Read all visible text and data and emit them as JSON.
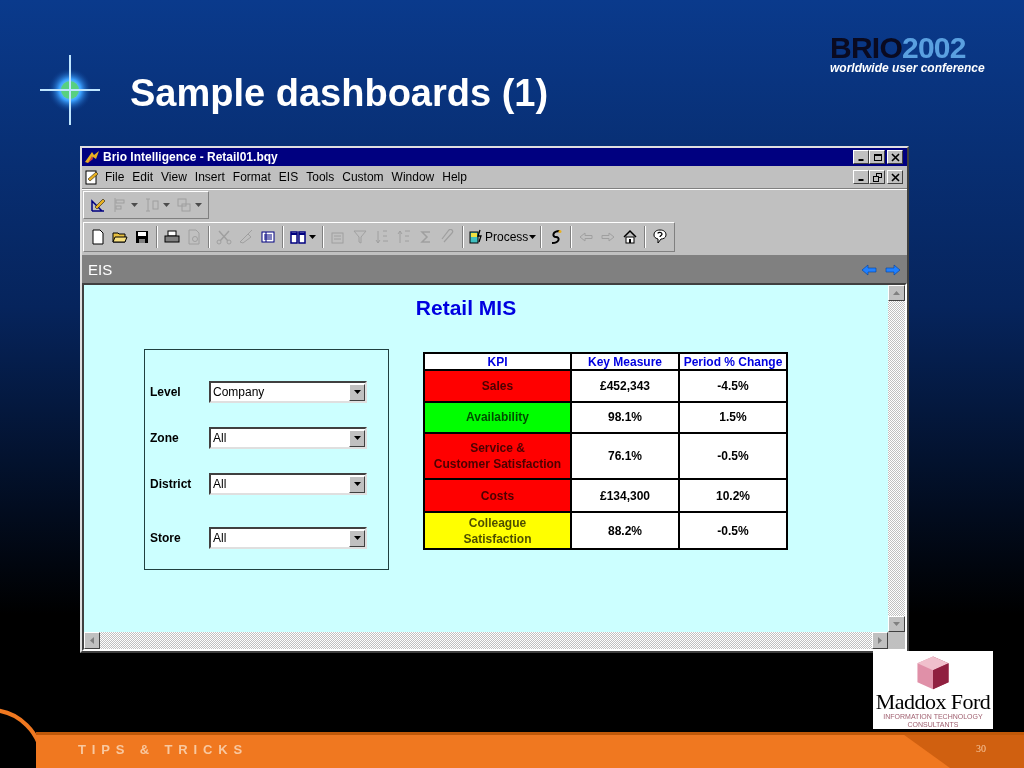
{
  "slide": {
    "title": "Sample dashboards (1)",
    "page": "30",
    "footer": "TIPS & TRICKS"
  },
  "brio_logo": {
    "wordmark": "BRIO",
    "year": "2002",
    "tagline": "worldwide user conference"
  },
  "partner_logo": {
    "name": "Maddox Ford",
    "tagline": "INFORMATION TECHNOLOGY CONSULTANTS"
  },
  "window": {
    "title": "Brio Intelligence - Retail01.bqy"
  },
  "menu": [
    "File",
    "Edit",
    "View",
    "Insert",
    "Format",
    "EIS",
    "Tools",
    "Custom",
    "Window",
    "Help"
  ],
  "toolbar_1": [
    [
      {
        "kind": "icon",
        "disabled": false,
        "dropdown": false
      },
      {
        "kind": "icon",
        "disabled": true,
        "dropdown": true
      },
      {
        "kind": "icon",
        "disabled": true,
        "dropdown": true
      },
      {
        "kind": "icon",
        "disabled": true,
        "dropdown": true
      }
    ]
  ],
  "toolbar_2": [
    [
      {
        "kind": "icon",
        "disabled": false,
        "dropdown": false
      },
      {
        "kind": "icon",
        "disabled": false,
        "dropdown": false
      },
      {
        "kind": "icon",
        "disabled": false,
        "dropdown": false
      }
    ],
    [
      {
        "kind": "icon",
        "disabled": false,
        "dropdown": false
      },
      {
        "kind": "icon",
        "disabled": true,
        "dropdown": false
      }
    ],
    [
      {
        "kind": "icon",
        "disabled": true,
        "dropdown": false
      },
      {
        "kind": "icon",
        "disabled": true,
        "dropdown": false
      },
      {
        "kind": "icon",
        "disabled": false,
        "dropdown": false
      }
    ],
    [
      {
        "kind": "icon",
        "disabled": false,
        "dropdown": true
      }
    ],
    [
      {
        "kind": "icon",
        "disabled": true,
        "dropdown": false
      },
      {
        "kind": "icon",
        "disabled": true,
        "dropdown": false
      },
      {
        "kind": "icon",
        "disabled": true,
        "dropdown": false
      },
      {
        "kind": "icon",
        "disabled": true,
        "dropdown": false
      },
      {
        "kind": "icon",
        "disabled": true,
        "dropdown": false
      },
      {
        "kind": "icon",
        "disabled": true,
        "dropdown": false
      }
    ],
    [
      {
        "kind": "text",
        "label": "Process",
        "disabled": false,
        "dropdown": true
      }
    ],
    [
      {
        "kind": "icon",
        "disabled": false,
        "dropdown": false
      }
    ],
    [
      {
        "kind": "icon",
        "disabled": true,
        "dropdown": false
      },
      {
        "kind": "icon",
        "disabled": true,
        "dropdown": false
      },
      {
        "kind": "icon",
        "disabled": false,
        "dropdown": false
      }
    ],
    [
      {
        "kind": "icon",
        "disabled": false,
        "dropdown": false
      }
    ]
  ],
  "section": {
    "title": "EIS"
  },
  "dashboard": {
    "title": "Retail MIS",
    "filters": [
      {
        "label": "Level",
        "value": "Company"
      },
      {
        "label": "Zone",
        "value": "All"
      },
      {
        "label": "District",
        "value": "All"
      },
      {
        "label": "Store",
        "value": "All"
      }
    ],
    "table": {
      "columns": [
        "KPI",
        "Key Measure",
        "Period % Change"
      ],
      "rows": [
        {
          "kpi": "Sales",
          "color": "#ff0000",
          "measure": "£452,343",
          "change": "-4.5%"
        },
        {
          "kpi": "Availability",
          "color": "#00ff00",
          "measure": "98.1%",
          "change": "1.5%"
        },
        {
          "kpi": "Service &\nCustomer Satisfaction",
          "color": "#ff0000",
          "measure": "76.1%",
          "change": "-0.5%"
        },
        {
          "kpi": "Costs",
          "color": "#ff0000",
          "measure": "£134,300",
          "change": "10.2%"
        },
        {
          "kpi": "Colleague\nSatisfaction",
          "color": "#ffff00",
          "measure": "88.2%",
          "change": "-0.5%"
        }
      ]
    }
  }
}
